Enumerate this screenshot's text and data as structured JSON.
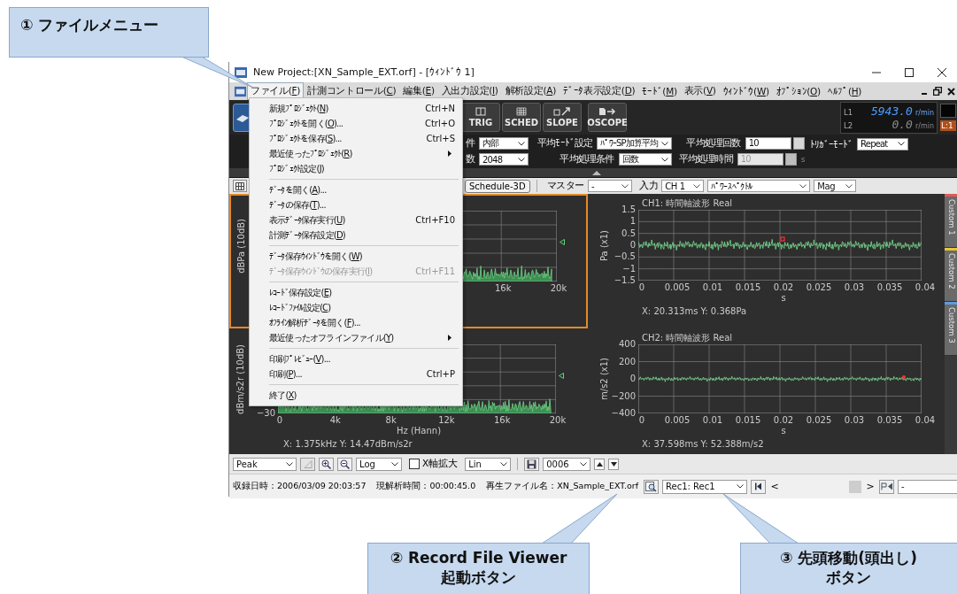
{
  "callouts": [
    {
      "text": "① ファイルメニュー"
    },
    {
      "text": "② Record File Viewer\n起動ボタン"
    },
    {
      "text": "③ 先頭移動(頭出し)\nボタン"
    }
  ],
  "window": {
    "title": "New Project:[XN_Sample_EXT.orf] - [ｳｨﾝﾄﾞｳ 1]"
  },
  "menubar": [
    {
      "label": "ファイル(F)",
      "selected": true
    },
    {
      "label": "計測コントロール(C)",
      "selected": false
    },
    {
      "label": "編集(E)",
      "selected": false
    },
    {
      "label": "入出力設定(I)",
      "selected": false
    },
    {
      "label": "解析設定(A)",
      "selected": false
    },
    {
      "label": "ﾃﾞｰﾀ表示設定(D)",
      "selected": false
    },
    {
      "label": "ﾓｰﾄﾞ(M)",
      "selected": false
    },
    {
      "label": "表示(V)",
      "selected": false
    },
    {
      "label": "ｳｨﾝﾄﾞｳ(W)",
      "selected": false
    },
    {
      "label": "ｵﾌﾟｼｮﾝ(O)",
      "selected": false
    },
    {
      "label": "ﾍﾙﾌﾟ(H)",
      "selected": false
    }
  ],
  "file_menu": [
    {
      "kind": "item",
      "label": "新規ﾌﾟﾛｼﾞｪｸﾄ(N)",
      "shortcut": "Ctrl+N",
      "submenu": false,
      "disabled": false
    },
    {
      "kind": "item",
      "label": "ﾌﾟﾛｼﾞｪｸﾄを開く(O)...",
      "shortcut": "Ctrl+O",
      "submenu": false,
      "disabled": false
    },
    {
      "kind": "item",
      "label": "ﾌﾟﾛｼﾞｪｸﾄを保存(S)...",
      "shortcut": "Ctrl+S",
      "submenu": false,
      "disabled": false
    },
    {
      "kind": "item",
      "label": "最近使ったﾌﾟﾛｼﾞｪｸﾄ(R)",
      "submenu": true,
      "disabled": false
    },
    {
      "kind": "item",
      "label": "ﾌﾟﾛｼﾞｪｸﾄ設定(J)",
      "submenu": false,
      "disabled": false
    },
    {
      "kind": "separator"
    },
    {
      "kind": "item",
      "label": "ﾃﾞｰﾀを開く(A)...",
      "submenu": false,
      "disabled": false
    },
    {
      "kind": "item",
      "label": "ﾃﾞｰﾀの保存(T)...",
      "submenu": false,
      "disabled": false
    },
    {
      "kind": "item",
      "label": "表示ﾃﾞｰﾀ保存実行(U)",
      "shortcut": "Ctrl+F10",
      "submenu": false,
      "disabled": false
    },
    {
      "kind": "item",
      "label": "計測ﾃﾞｰﾀ保存設定(D)",
      "submenu": false,
      "disabled": false
    },
    {
      "kind": "separator"
    },
    {
      "kind": "item",
      "label": "ﾃﾞｰﾀ保存ｳｨﾝﾄﾞｳを開く(W)",
      "submenu": false,
      "disabled": false
    },
    {
      "kind": "item",
      "label": "ﾃﾞｰﾀ保存ｳｨﾝﾄﾞｳの保存実行(I)",
      "shortcut": "Ctrl+F11",
      "submenu": false,
      "disabled": true
    },
    {
      "kind": "separator"
    },
    {
      "kind": "item",
      "label": "ﾚｺｰﾄﾞ保存設定(E)",
      "submenu": false,
      "disabled": false
    },
    {
      "kind": "item",
      "label": "ﾚｺｰﾄﾞﾌｧｲﾙ設定(C)",
      "submenu": false,
      "disabled": false
    },
    {
      "kind": "item",
      "label": "ｵﾌﾗｲﾝ解析ﾃﾞｰﾀを開く(F)...",
      "submenu": false,
      "disabled": false
    },
    {
      "kind": "item",
      "label": "最近使ったオフラインファイル(Y)",
      "submenu": true,
      "disabled": false
    },
    {
      "kind": "separator"
    },
    {
      "kind": "item",
      "label": "印刷ﾌﾟﾚﾋﾞｭｰ(V)...",
      "submenu": false,
      "disabled": false
    },
    {
      "kind": "item",
      "label": "印刷(P)...",
      "shortcut": "Ctrl+P",
      "submenu": false,
      "disabled": false
    },
    {
      "kind": "separator"
    },
    {
      "kind": "item",
      "label": "終了(X)",
      "submenu": false,
      "disabled": false
    }
  ],
  "toolbar": {
    "buttons": [
      {
        "label": "TRIG",
        "kind": "trig"
      },
      {
        "label": "SCHED",
        "kind": "sched"
      },
      {
        "label": "SLOPE",
        "kind": "slope"
      },
      {
        "label": "OSCOPE",
        "kind": "oscope"
      }
    ],
    "readouts": [
      {
        "channel": "L1",
        "value": "5943.0",
        "unit": "r/min",
        "active": true
      },
      {
        "channel": "L2",
        "value": "0.0",
        "unit": "r/min",
        "active": false
      }
    ],
    "level_badge": "L:1"
  },
  "settings": [
    [
      {
        "label": "件",
        "value": "内部",
        "kind": "select"
      },
      {
        "label": "数",
        "value": "2048",
        "kind": "select"
      }
    ],
    [
      {
        "label": "平均ﾓｰﾄﾞ設定",
        "value": "ﾊﾟﾜｰSP加算平均",
        "kind": "select"
      },
      {
        "label": "平均処理条件",
        "value": "回数",
        "kind": "select"
      }
    ],
    [
      {
        "label": "平均処理回数",
        "value": "10",
        "kind": "spin",
        "disabled": false
      },
      {
        "label": "平均処理時間",
        "value": "10",
        "kind": "spin",
        "disabled": true,
        "unit": "s"
      }
    ],
    [
      {
        "label": "ﾄﾘｶﾞｰﾓｰﾄﾞ",
        "value": "Repeat",
        "kind": "select"
      }
    ]
  ],
  "chart_toolbar": [
    {
      "kind": "grid"
    },
    {
      "kind": "button",
      "label": "Schedule-3D"
    },
    {
      "kind": "label",
      "label": "マスター"
    },
    {
      "kind": "select",
      "value": "-"
    },
    {
      "kind": "label",
      "label": "入力"
    },
    {
      "kind": "select",
      "value": "CH 1"
    },
    {
      "kind": "select",
      "value": "ﾊﾟﾜｰｽﾍﾟｸﾄﾙ"
    },
    {
      "kind": "select",
      "value": "Mag"
    }
  ],
  "charts": [
    {
      "kind": "spectrum",
      "selected": true,
      "ylabel": "dBPa (10dB)",
      "xticks": [
        "16k",
        "20k"
      ]
    },
    {
      "kind": "waveform",
      "selected": false,
      "title": "CH1: 時間軸波形 Real",
      "ylabel": "Pa (x1)",
      "yticks": [
        "1.5",
        "1",
        "0.5",
        "0",
        "−0.5",
        "−1",
        "−1.5"
      ],
      "xticks": [
        "0",
        "0.005",
        "0.01",
        "0.015",
        "0.02",
        "0.025",
        "0.03",
        "0.035",
        "0.04"
      ],
      "xlabel": "s",
      "readout": "X: 20.313ms Y: 0.368Pa"
    },
    {
      "kind": "spectrum",
      "selected": false,
      "ylabel": "dBm/s2r (10dB)",
      "yticks": [
        "−30"
      ],
      "xticks": [
        "0",
        "4k",
        "8k",
        "12k",
        "16k",
        "20k"
      ],
      "xlabel": "Hz (Hann)",
      "readout": "X: 1.375kHz Y: 14.47dBm/s2r"
    },
    {
      "kind": "waveform",
      "selected": false,
      "title": "CH2: 時間軸波形 Real",
      "ylabel": "m/s2 (x1)",
      "yticks": [
        "400",
        "200",
        "0",
        "−200",
        "−400"
      ],
      "xticks": [
        "0",
        "0.005",
        "0.01",
        "0.015",
        "0.02",
        "0.025",
        "0.03",
        "0.035",
        "0.04"
      ],
      "xlabel": "s",
      "readout": "X: 37.598ms Y: 52.388m/s2"
    }
  ],
  "side_tabs": [
    {
      "label": "Custom 1",
      "color": "#e05a5a"
    },
    {
      "label": "Custom 2",
      "color": "#e8c53a"
    },
    {
      "label": "Custom 3",
      "color": "#5a9be0"
    }
  ],
  "bottom_toolbar": [
    {
      "kind": "select",
      "value": "Peak"
    },
    {
      "kind": "marker",
      "disabled": true
    },
    {
      "kind": "zoom-in"
    },
    {
      "kind": "zoom-out"
    },
    {
      "kind": "select",
      "value": "Log"
    },
    {
      "kind": "checkbox",
      "label": "X軸拡大",
      "checked": false
    },
    {
      "kind": "select",
      "value": "Lin"
    },
    {
      "kind": "save"
    },
    {
      "kind": "select",
      "value": "0006"
    },
    {
      "kind": "up"
    },
    {
      "kind": "down"
    }
  ],
  "status_bar": {
    "recorded": "収録日時：2006/03/09 20:03:57",
    "elapsed": "現解析時間：00:00:45.0",
    "file": "再生ファイル名：XN_Sample_EXT.orf",
    "record": "Rec1: Rec1",
    "prev": "<",
    "next": ">",
    "marker": "-"
  }
}
